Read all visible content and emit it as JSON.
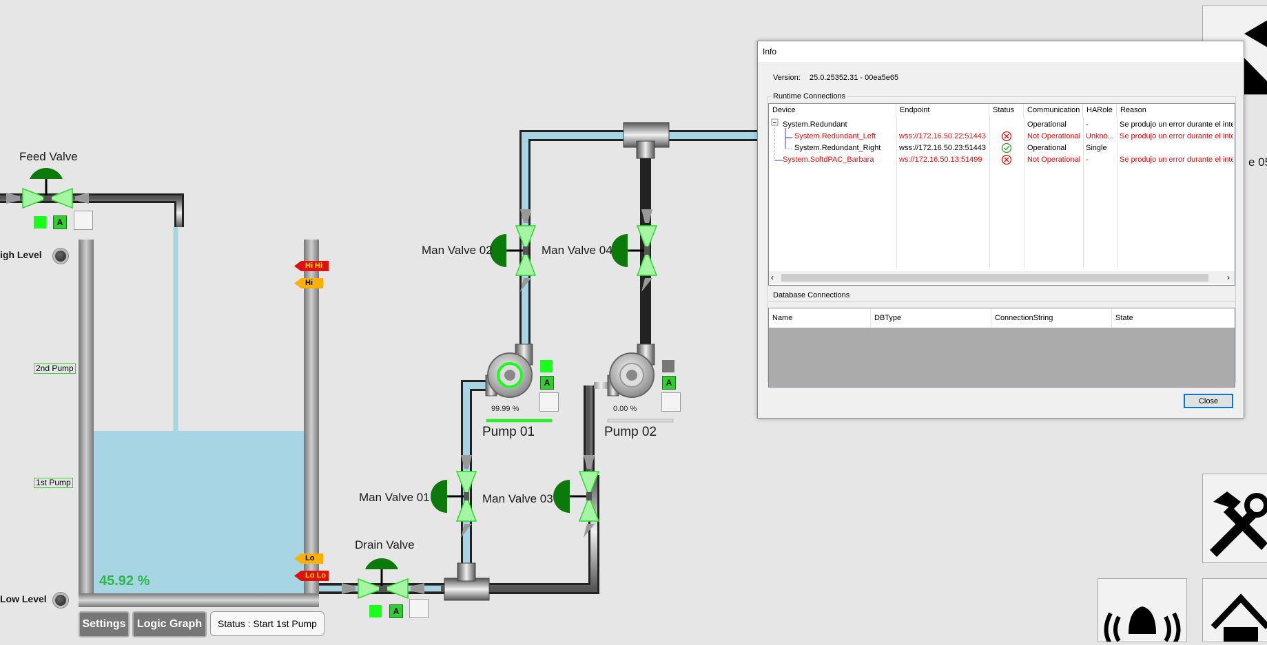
{
  "labels": {
    "feed_valve": "Feed Valve",
    "high_level": "igh Level",
    "low_level": "Low Level",
    "drain_valve": "Drain Valve",
    "man_valve_01": "Man Valve 01",
    "man_valve_02": "Man Valve 02",
    "man_valve_03": "Man Valve 03",
    "man_valve_04": "Man Valve 04",
    "pump_01": "Pump 01",
    "pump_02": "Pump 02",
    "cut_label_right": "e 05"
  },
  "tank": {
    "level_text": "45.92 %",
    "level_fraction": 0.4592,
    "tag_2nd_pump": "2nd Pump",
    "tag_1st_pump": "1st Pump",
    "alarm_hihi": "Hi Hi",
    "alarm_hi": "Hi",
    "alarm_lo": "Lo",
    "alarm_lolo": "Lo Lo"
  },
  "pumps": {
    "pump01_speed": "99.99 %",
    "pump01_fraction": 0.9999,
    "pump02_speed": "0.00 %",
    "pump02_fraction": 0.0
  },
  "mode_label": "A",
  "buttons": {
    "settings": "Settings",
    "logic_graph": "Logic Graph",
    "status": "Status : Start 1st Pump"
  },
  "colors": {
    "water": "#a7d5e4",
    "valve_green": "#0b7a0b",
    "valve_body": "#a5f5a5",
    "running": "#19ff19",
    "stopped": "#777777",
    "alarm_red": "#e01010",
    "alarm_yellow": "#ffb000"
  },
  "dialog": {
    "title": "Info",
    "version_label": "Version:",
    "version_value": "25.0.25352.31 - 00ea5e65",
    "runtime_title": "Runtime Connections",
    "runtime_headers": [
      "Device",
      "Endpoint",
      "Status",
      "Communication",
      "HARole",
      "Reason"
    ],
    "rows": [
      {
        "device": "System.Redundant",
        "endpoint": "",
        "comm": "Operational",
        "harole": "-",
        "reason": "Se produjo un error durante el inter",
        "error": false,
        "status": "none"
      },
      {
        "device": "System.Redundant_Left",
        "endpoint": "wss://172.16.50.22:51443",
        "comm": "Not Operational",
        "harole": "Unkno...",
        "reason": "Se produjo un error durante el inter",
        "error": true,
        "status": "error"
      },
      {
        "device": "System.Redundant_Right",
        "endpoint": "wss://172.16.50.23:51443",
        "comm": "Operational",
        "harole": "Single",
        "reason": "",
        "error": false,
        "status": "ok"
      },
      {
        "device": "System.SoftdPAC_Barbara",
        "endpoint": "ws://172.16.50.13:51499",
        "comm": "Not Operational",
        "harole": "-",
        "reason": "Se produjo un error durante el inter",
        "error": true,
        "status": "error"
      }
    ],
    "db_title": "Database Connections",
    "db_headers": [
      "Name",
      "DBType",
      "ConnectionString",
      "State"
    ],
    "close": "Close"
  }
}
